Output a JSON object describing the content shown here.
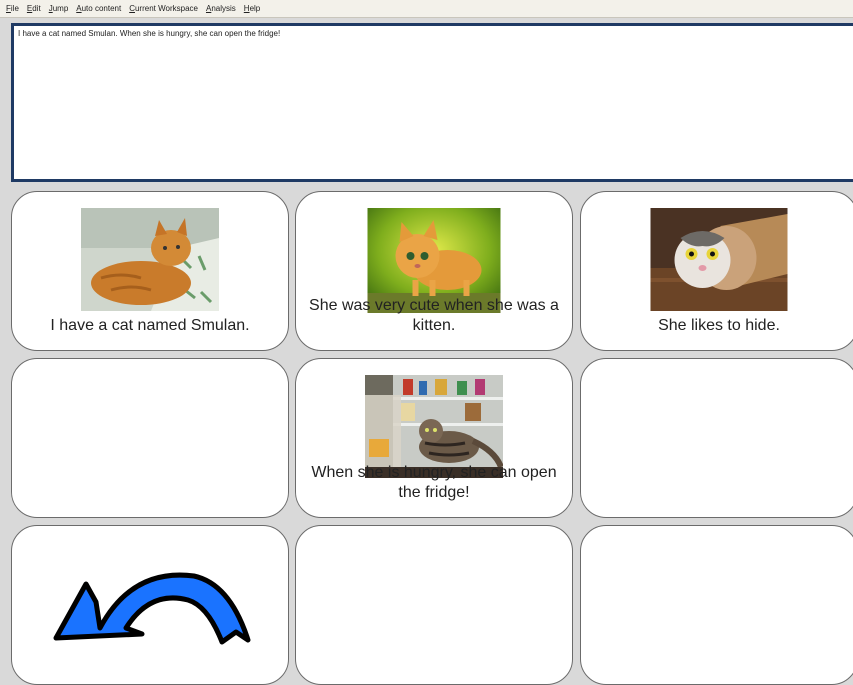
{
  "menu": [
    {
      "accel": "F",
      "rest": "ile"
    },
    {
      "accel": "E",
      "rest": "dit"
    },
    {
      "accel": "J",
      "rest": "ump"
    },
    {
      "accel": "A",
      "rest": "uto content"
    },
    {
      "accel": "C",
      "rest": "urrent Workspace"
    },
    {
      "accel": "A",
      "rest": "nalysis"
    },
    {
      "accel": "H",
      "rest": "elp"
    }
  ],
  "message": "I have a cat named Smulan. When she is hungry, she can open the fridge!",
  "cells": [
    {
      "label": "I have a cat named Smulan.",
      "image": "orange-cat-lying-photo"
    },
    {
      "label": "She was very cute when she was a kitten.",
      "image": "orange-kitten-photo"
    },
    {
      "label": "She likes to hide.",
      "image": "cat-in-paper-roll-photo"
    },
    {
      "label": "",
      "image": ""
    },
    {
      "label": "When she is hungry, she can open the fridge!",
      "image": "cat-in-fridge-photo"
    },
    {
      "label": "",
      "image": ""
    },
    {
      "label": "",
      "image": "blue-back-arrow-icon"
    },
    {
      "label": "",
      "image": ""
    },
    {
      "label": "",
      "image": ""
    }
  ],
  "colors": {
    "message_border": "#1f3a64",
    "arrow_fill": "#1a73ff",
    "background": "#d9d9d9"
  }
}
